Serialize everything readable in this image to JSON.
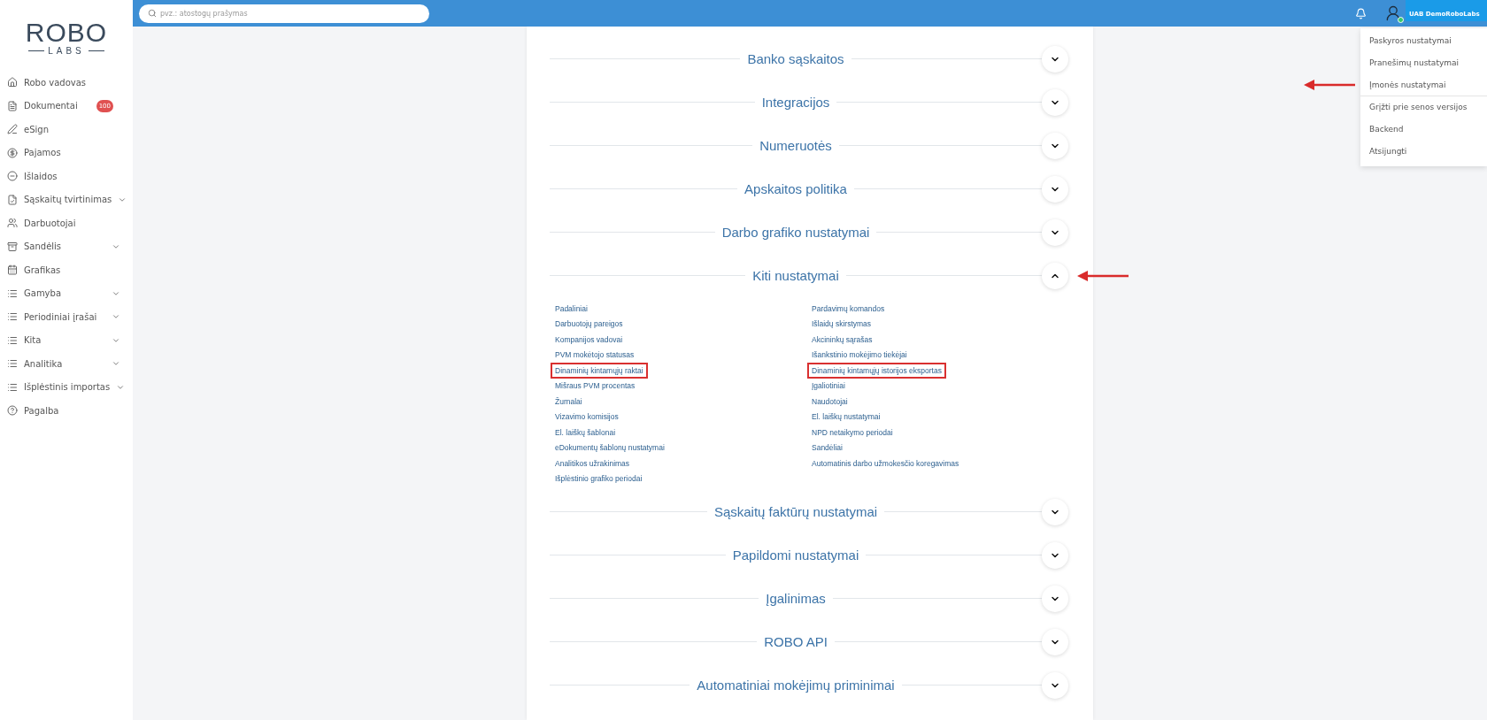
{
  "logo": {
    "word": "ROBO",
    "subword": "LABS"
  },
  "sidebar": {
    "items": [
      {
        "label": "Robo vadovas",
        "kind": "home",
        "expandable": false
      },
      {
        "label": "Dokumentai",
        "kind": "document",
        "expandable": false,
        "badge": "100"
      },
      {
        "label": "eSign",
        "kind": "pen",
        "expandable": false
      },
      {
        "label": "Pajamos",
        "kind": "income",
        "expandable": false
      },
      {
        "label": "Išlaidos",
        "kind": "expense",
        "expandable": false
      },
      {
        "label": "Sąskaitų tvirtinimas",
        "kind": "invoice",
        "expandable": true
      },
      {
        "label": "Darbuotojai",
        "kind": "people",
        "expandable": false
      },
      {
        "label": "Sandėlis",
        "kind": "warehouse",
        "expandable": true
      },
      {
        "label": "Grafikas",
        "kind": "calendar",
        "expandable": false
      },
      {
        "label": "Gamyba",
        "kind": "list",
        "expandable": true
      },
      {
        "label": "Periodiniai įrašai",
        "kind": "list",
        "expandable": true
      },
      {
        "label": "Kita",
        "kind": "list",
        "expandable": true
      },
      {
        "label": "Analitika",
        "kind": "list",
        "expandable": true
      },
      {
        "label": "Išplėstinis importas",
        "kind": "list",
        "expandable": true
      },
      {
        "label": "Pagalba",
        "kind": "help",
        "expandable": false
      }
    ]
  },
  "search": {
    "placeholder": "pvz.: atostogų prašymas"
  },
  "user": {
    "name": "UAB DemoRoboLabs",
    "online": true
  },
  "user_menu": {
    "items": [
      {
        "label": "Paskyros nustatymai",
        "pointed": false,
        "divider_after": false
      },
      {
        "label": "Pranešimų nustatymai",
        "pointed": false,
        "divider_after": false
      },
      {
        "label": "Įmonės nustatymai",
        "pointed": true,
        "divider_after": true
      },
      {
        "label": "Grįžti prie senos versijos",
        "pointed": false,
        "divider_after": false
      },
      {
        "label": "Backend",
        "pointed": false,
        "divider_after": false
      },
      {
        "label": "Atsijungti",
        "pointed": false,
        "divider_after": false
      }
    ]
  },
  "sections": [
    {
      "title": "Banko sąskaitos",
      "expanded": false,
      "pointed": false
    },
    {
      "title": "Integracijos",
      "expanded": false,
      "pointed": false
    },
    {
      "title": "Numeruotės",
      "expanded": false,
      "pointed": false
    },
    {
      "title": "Apskaitos politika",
      "expanded": false,
      "pointed": false
    },
    {
      "title": "Darbo grafiko nustatymai",
      "expanded": false,
      "pointed": false
    },
    {
      "title": "Kiti nustatymai",
      "expanded": true,
      "pointed": true,
      "columns": [
        [
          {
            "label": "Padaliniai",
            "highlighted": false
          },
          {
            "label": "Darbuotojų pareigos",
            "highlighted": false
          },
          {
            "label": "Kompanijos vadovai",
            "highlighted": false
          },
          {
            "label": "PVM mokėtojo statusas",
            "highlighted": false
          },
          {
            "label": "Dinaminių kintamųjų raktai",
            "highlighted": true
          },
          {
            "label": "Mišraus PVM procentas",
            "highlighted": false
          },
          {
            "label": "Žurnalai",
            "highlighted": false
          },
          {
            "label": "Vizavimo komisijos",
            "highlighted": false
          },
          {
            "label": "El. laiškų šablonai",
            "highlighted": false
          },
          {
            "label": "eDokumentų šablonų nustatymai",
            "highlighted": false
          },
          {
            "label": "Analitikos užrakinimas",
            "highlighted": false
          },
          {
            "label": "Išplėstinio grafiko periodai",
            "highlighted": false
          }
        ],
        [
          {
            "label": "Pardavimų komandos",
            "highlighted": false
          },
          {
            "label": "Išlaidų skirstymas",
            "highlighted": false
          },
          {
            "label": "Akcininkų sąrašas",
            "highlighted": false
          },
          {
            "label": "Išankstinio mokėjimo tiekėjai",
            "highlighted": false
          },
          {
            "label": "Dinaminių kintamųjų istorijos eksportas",
            "highlighted": true
          },
          {
            "label": "Įgaliotiniai",
            "highlighted": false
          },
          {
            "label": "Naudotojai",
            "highlighted": false
          },
          {
            "label": "El. laiškų nustatymai",
            "highlighted": false
          },
          {
            "label": "NPD netaikymo periodai",
            "highlighted": false
          },
          {
            "label": "Sandėliai",
            "highlighted": false
          },
          {
            "label": "Automatinis darbo užmokesčio koregavimas",
            "highlighted": false
          }
        ]
      ]
    },
    {
      "title": "Sąskaitų faktūrų nustatymai",
      "expanded": false,
      "pointed": false
    },
    {
      "title": "Papildomi nustatymai",
      "expanded": false,
      "pointed": false
    },
    {
      "title": "Įgalinimas",
      "expanded": false,
      "pointed": false
    },
    {
      "title": "ROBO API",
      "expanded": false,
      "pointed": false
    },
    {
      "title": "Automatiniai mokėjimų priminimai",
      "expanded": false,
      "pointed": false
    }
  ]
}
